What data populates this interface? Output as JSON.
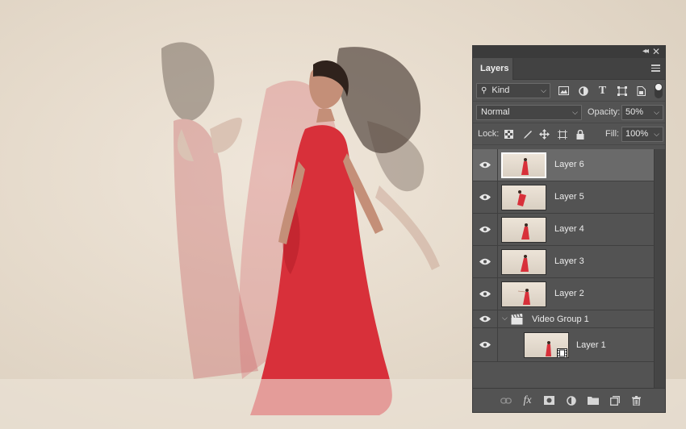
{
  "panel": {
    "tab_label": "Layers",
    "filter": {
      "kind_label": "Kind",
      "icons": [
        "image-filter-icon",
        "adjustment-filter-icon",
        "type-filter-icon",
        "shape-filter-icon",
        "smart-object-filter-icon"
      ]
    },
    "blend_mode": "Normal",
    "opacity": {
      "label": "Opacity:",
      "value": "50%"
    },
    "lock": {
      "label": "Lock:",
      "icons": [
        "lock-transparent-icon",
        "lock-image-icon",
        "lock-position-icon",
        "lock-artboard-icon",
        "lock-all-icon"
      ]
    },
    "fill": {
      "label": "Fill:",
      "value": "100%"
    }
  },
  "layers": [
    {
      "name": "Layer 6",
      "selected": true,
      "visible": true
    },
    {
      "name": "Layer 5",
      "selected": false,
      "visible": true
    },
    {
      "name": "Layer 4",
      "selected": false,
      "visible": true
    },
    {
      "name": "Layer 3",
      "selected": false,
      "visible": true
    },
    {
      "name": "Layer 2",
      "selected": false,
      "visible": true
    }
  ],
  "group": {
    "name": "Video Group 1",
    "expanded": true,
    "children": [
      {
        "name": "Layer 1",
        "visible": true
      }
    ]
  },
  "footer_icons": [
    "link-layers-icon",
    "fx-icon",
    "add-mask-icon",
    "adjustment-layer-icon",
    "new-group-icon",
    "new-layer-icon",
    "delete-layer-icon"
  ],
  "colors": {
    "panel_bg": "#535353",
    "selected_row": "#6a6a6a",
    "dress_red": "#d8303a"
  }
}
